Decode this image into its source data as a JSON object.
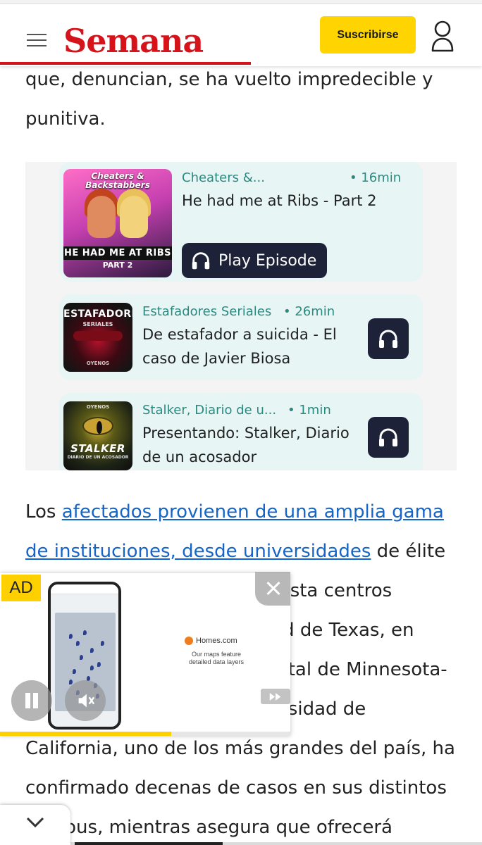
{
  "header": {
    "logo": "Semana",
    "subscribe_label": "Suscribirse"
  },
  "colors": {
    "brand_red": "#d6131b",
    "accent_yellow": "#ffd400",
    "link_blue": "#1565c8",
    "player_dark": "#1d2238",
    "podcast_teal": "#2a8a80"
  },
  "icons": {
    "menu": "hamburger-menu-icon",
    "user": "user-profile-icon",
    "headphones": "headphones-icon",
    "close": "close-icon",
    "pause": "pause-icon",
    "mute": "speaker-muted-icon",
    "skip": "fast-forward-icon",
    "collapse": "chevron-down-icon"
  },
  "article": {
    "intro_text": "que, denuncian, se ha vuelto impredecible y punitiva.",
    "p2_before": "Los ",
    "p2_link": "afectados provienen de una amplia gama de instituciones, desde universidades",
    "p2_after": " de élite como Harvard y Stanford, hasta centros públicos como la Universidad de Texas, en Austin, o la Universidad Estatal de Minnesota-Mankato. Mientras, la Universidad de",
    "p3_text": "California, uno de los más grandes del país, ha confirmado decenas de casos en sus distintos campus, mientras asegura que ofrecerá asesoría"
  },
  "podcasts": [
    {
      "show": "Cheaters &...",
      "duration": "• 16min",
      "title": "He had me at Ribs - Part 2",
      "play_label": "Play Episode",
      "cover_top": "Cheaters & Backstabbers",
      "cover_mid": "HE HAD ME AT RIBS",
      "cover_bot": "PART 2"
    },
    {
      "show": "Estafadores Seriales",
      "duration": "• 26min",
      "title": "De estafador a suicida - El caso de Javier Biosa",
      "cover_top": "ESTAFADORE$",
      "cover_sub": "SERIALES",
      "cover_bot": "OYENOS"
    },
    {
      "show": "Stalker, Diario de u...",
      "duration": "• 1min",
      "title": "Presentando: Stalker, Diario de un acosador",
      "cover_top": "OYENOS",
      "cover_mid": "STALKER",
      "cover_bot": "DIARIO DE UN ACOSADOR"
    }
  ],
  "ad": {
    "badge": "AD",
    "brand": "Homes.com",
    "tagline": "Our maps feature detailed data layers",
    "progress": 0.59
  }
}
